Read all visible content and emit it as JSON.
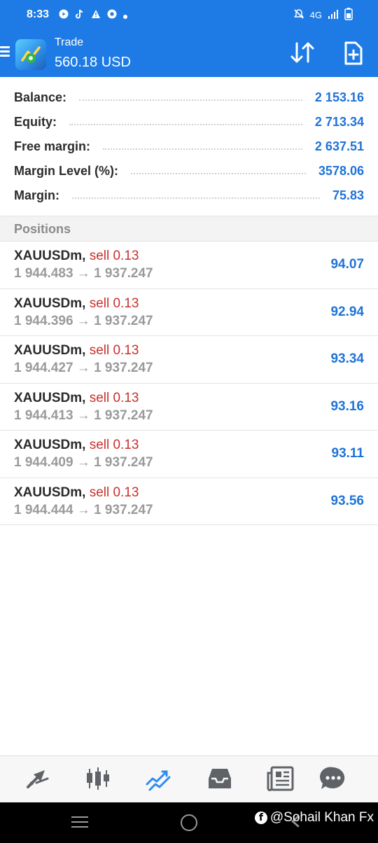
{
  "status_bar": {
    "time": "8:33",
    "network": "4G",
    "icons": [
      "youtube-icon",
      "tiktok-icon",
      "alert-icon",
      "chrome-icon",
      "dot-icon",
      "mute-icon",
      "signal-icon",
      "battery-icon"
    ]
  },
  "app_bar": {
    "title": "Trade",
    "subtitle": "560.18 USD"
  },
  "summary": [
    {
      "label": "Balance:",
      "value": "2 153.16"
    },
    {
      "label": "Equity:",
      "value": "2 713.34"
    },
    {
      "label": "Free margin:",
      "value": "2 637.51"
    },
    {
      "label": "Margin Level (%):",
      "value": "3578.06"
    },
    {
      "label": "Margin:",
      "value": "75.83"
    }
  ],
  "section_title": "Positions",
  "positions": [
    {
      "symbol": "XAUUSDm,",
      "side": "sell 0.13",
      "prices": "1 944.483 → 1 937.247",
      "profit": "94.07"
    },
    {
      "symbol": "XAUUSDm,",
      "side": "sell 0.13",
      "prices": "1 944.396 → 1 937.247",
      "profit": "92.94"
    },
    {
      "symbol": "XAUUSDm,",
      "side": "sell 0.13",
      "prices": "1 944.427 → 1 937.247",
      "profit": "93.34"
    },
    {
      "symbol": "XAUUSDm,",
      "side": "sell 0.13",
      "prices": "1 944.413 → 1 937.247",
      "profit": "93.16"
    },
    {
      "symbol": "XAUUSDm,",
      "side": "sell 0.13",
      "prices": "1 944.409 → 1 937.247",
      "profit": "93.11"
    },
    {
      "symbol": "XAUUSDm,",
      "side": "sell 0.13",
      "prices": "1 944.444 → 1 937.247",
      "profit": "93.56"
    }
  ],
  "bottom_nav": {
    "active": "trade",
    "items": [
      "quotes-icon",
      "chart-icon",
      "trade-icon",
      "history-icon",
      "news-icon",
      "chat-icon"
    ]
  },
  "watermark": "@Sohail Khan Fx",
  "colors": {
    "primary": "#1e7be6",
    "profit": "#1e73d8",
    "sell": "#c9302c"
  }
}
